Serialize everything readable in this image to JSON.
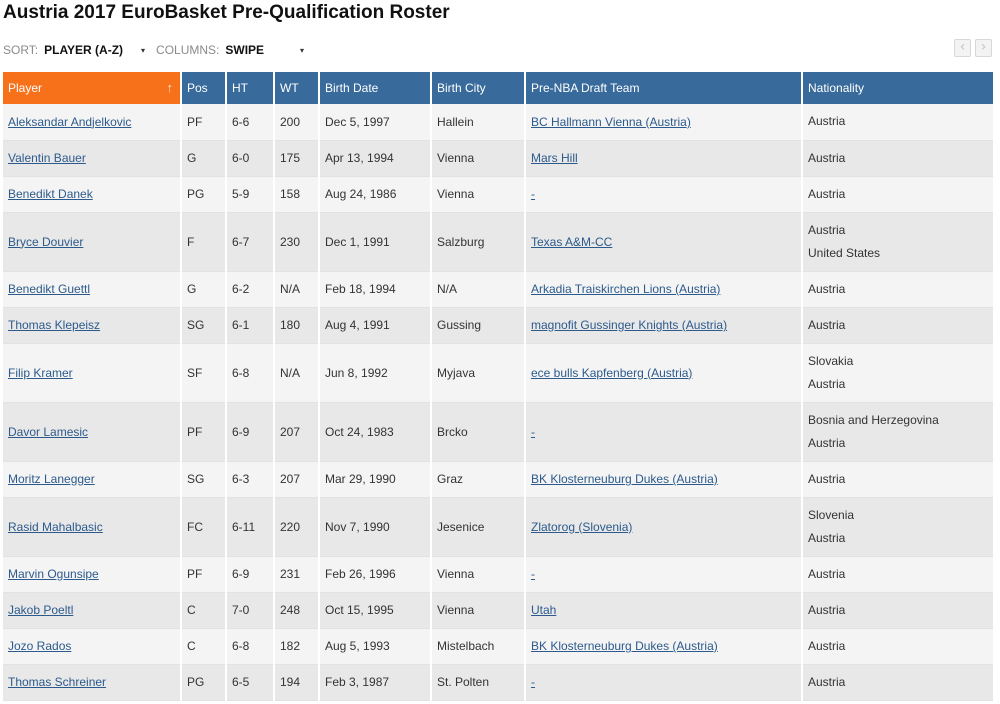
{
  "page": {
    "title": "Austria 2017 EuroBasket Pre-Qualification Roster"
  },
  "controls": {
    "sort_label": "SORT:",
    "sort_value": "PLAYER (A-Z)",
    "columns_label": "COLUMNS:",
    "columns_value": "SWIPE",
    "caret": "▾",
    "prev_label": "‹",
    "next_label": "›"
  },
  "table": {
    "headers": {
      "player": "Player",
      "sort_arrow": "↑",
      "pos": "Pos",
      "ht": "HT",
      "wt": "WT",
      "birth_date": "Birth Date",
      "birth_city": "Birth City",
      "draft_team": "Pre-NBA Draft Team",
      "nationality": "Nationality"
    },
    "rows": [
      {
        "player": "Aleksandar Andjelkovic",
        "pos": "PF",
        "ht": "6-6",
        "wt": "200",
        "birth_date": "Dec 5, 1997",
        "birth_city": "Hallein",
        "draft_team": "BC Hallmann Vienna (Austria)",
        "nationality": [
          "Austria"
        ]
      },
      {
        "player": "Valentin Bauer",
        "pos": "G",
        "ht": "6-0",
        "wt": "175",
        "birth_date": "Apr 13, 1994",
        "birth_city": "Vienna",
        "draft_team": "Mars Hill",
        "nationality": [
          "Austria"
        ]
      },
      {
        "player": "Benedikt Danek",
        "pos": "PG",
        "ht": "5-9",
        "wt": "158",
        "birth_date": "Aug 24, 1986",
        "birth_city": "Vienna",
        "draft_team": "-",
        "nationality": [
          "Austria"
        ]
      },
      {
        "player": "Bryce Douvier",
        "pos": "F",
        "ht": "6-7",
        "wt": "230",
        "birth_date": "Dec 1, 1991",
        "birth_city": "Salzburg",
        "draft_team": "Texas A&M-CC",
        "nationality": [
          "Austria",
          "United States"
        ]
      },
      {
        "player": "Benedikt Guettl",
        "pos": "G",
        "ht": "6-2",
        "wt": "N/A",
        "birth_date": "Feb 18, 1994",
        "birth_city": "N/A",
        "draft_team": "Arkadia Traiskirchen Lions (Austria)",
        "nationality": [
          "Austria"
        ]
      },
      {
        "player": "Thomas Klepeisz",
        "pos": "SG",
        "ht": "6-1",
        "wt": "180",
        "birth_date": "Aug 4, 1991",
        "birth_city": "Gussing",
        "draft_team": "magnofit Gussinger Knights (Austria)",
        "nationality": [
          "Austria"
        ]
      },
      {
        "player": "Filip Kramer",
        "pos": "SF",
        "ht": "6-8",
        "wt": "N/A",
        "birth_date": "Jun 8, 1992",
        "birth_city": "Myjava",
        "draft_team": "ece bulls Kapfenberg (Austria)",
        "nationality": [
          "Slovakia",
          "Austria"
        ]
      },
      {
        "player": "Davor Lamesic",
        "pos": "PF",
        "ht": "6-9",
        "wt": "207",
        "birth_date": "Oct 24, 1983",
        "birth_city": "Brcko",
        "draft_team": "-",
        "nationality": [
          "Bosnia and Herzegovina",
          "Austria"
        ]
      },
      {
        "player": "Moritz Lanegger",
        "pos": "SG",
        "ht": "6-3",
        "wt": "207",
        "birth_date": "Mar 29, 1990",
        "birth_city": "Graz",
        "draft_team": "BK Klosterneuburg Dukes (Austria)",
        "nationality": [
          "Austria"
        ]
      },
      {
        "player": "Rasid Mahalbasic",
        "pos": "FC",
        "ht": "6-11",
        "wt": "220",
        "birth_date": "Nov 7, 1990",
        "birth_city": "Jesenice",
        "draft_team": "Zlatorog (Slovenia)",
        "nationality": [
          "Slovenia",
          "Austria"
        ]
      },
      {
        "player": "Marvin Ogunsipe",
        "pos": "PF",
        "ht": "6-9",
        "wt": "231",
        "birth_date": "Feb 26, 1996",
        "birth_city": "Vienna",
        "draft_team": "-",
        "nationality": [
          "Austria"
        ]
      },
      {
        "player": "Jakob Poeltl",
        "pos": "C",
        "ht": "7-0",
        "wt": "248",
        "birth_date": "Oct 15, 1995",
        "birth_city": "Vienna",
        "draft_team": "Utah",
        "nationality": [
          "Austria"
        ]
      },
      {
        "player": "Jozo Rados",
        "pos": "C",
        "ht": "6-8",
        "wt": "182",
        "birth_date": "Aug 5, 1993",
        "birth_city": "Mistelbach",
        "draft_team": "BK Klosterneuburg Dukes (Austria)",
        "nationality": [
          "Austria"
        ]
      },
      {
        "player": "Thomas Schreiner",
        "pos": "PG",
        "ht": "6-5",
        "wt": "194",
        "birth_date": "Feb 3, 1987",
        "birth_city": "St. Polten",
        "draft_team": "-",
        "nationality": [
          "Austria"
        ]
      }
    ]
  },
  "colors": {
    "header_bg": "#386a9b",
    "sorted_header_bg": "#f7711b",
    "link": "#2c5a8c",
    "row_odd": "#f4f4f4",
    "row_even": "#e8e8e8"
  }
}
